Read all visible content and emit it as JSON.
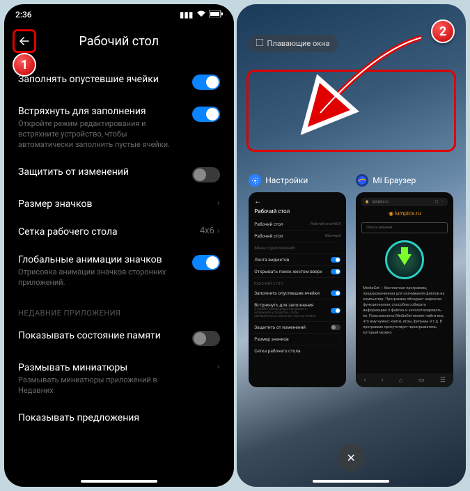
{
  "statusbar": {
    "time": "2:36"
  },
  "header": {
    "title": "Рабочий стол"
  },
  "settings": {
    "fill_empty": {
      "label": "Заполнять опустевшие ячейки",
      "on": true
    },
    "shake_fill": {
      "label": "Встряхнуть для заполнения",
      "sub": "Откройте режим редактирования и встряхните устройство, чтобы автоматически заполнить пустые ячейки.",
      "on": true
    },
    "protect": {
      "label": "Защитить от изменений",
      "on": false
    },
    "icon_size": {
      "label": "Размер значков"
    },
    "grid": {
      "label": "Сетка рабочего стола",
      "value": "4x6"
    },
    "global_anim": {
      "label": "Глобальные анимации значков",
      "sub": "Отрисовка анимации значков сторонних приложений.",
      "on": true
    },
    "section_recent": "НЕДАВНИЕ ПРИЛОЖЕНИЯ",
    "show_memory": {
      "label": "Показывать состояние памяти",
      "on": false
    },
    "blur_thumbs": {
      "label": "Размывать миниатюры",
      "sub": "Размывать миниатюры приложений в Недавних"
    },
    "show_suggestions": {
      "label": "Показывать предложения"
    }
  },
  "recents": {
    "floating": "Плавающие окна",
    "cards": {
      "settings": {
        "title": "Настройки",
        "rows": {
          "page_title": "Рабочий стол",
          "r1": "Рабочий стол",
          "r1v": "Рабочий стол MIUI",
          "r2": "Рабочий стол",
          "r2v": "Обычный",
          "r3": "Меню приложений",
          "r4": "Лента виджетов",
          "r5": "Открывать поиск жестом вверх",
          "sec": "РАБОЧИЙ СТОЛ",
          "r6": "Заполнять опустевшие ячейки",
          "r7": "Встряхнуть для заполнения",
          "r7s": "Откройте режим редактирования и встряхните устройство, чтобы автоматически заполнить пустые ячейки.",
          "r8": "Защитить от изменений",
          "r9": "Размер значков",
          "r10": "Сетка рабочего стола"
        }
      },
      "browser": {
        "title": "Mi Браузер",
        "url": "lumpics.ru",
        "brand": "lumpics.ru",
        "search": "Поиск решени...",
        "text": "MediaGet — бесплатная программа, предназначенная для скачивания файлов на компьютер. Программа обладает широким функционалом, способна собирать информацию о файлах и каталогизировать ее. Пользователь MediaGet может найти все, что ему нужно: книги, игры, фильмы и т.д. В программе присутствует проигрыватель, который можно"
      }
    }
  },
  "annotations": {
    "b1": "1",
    "b2": "2"
  }
}
